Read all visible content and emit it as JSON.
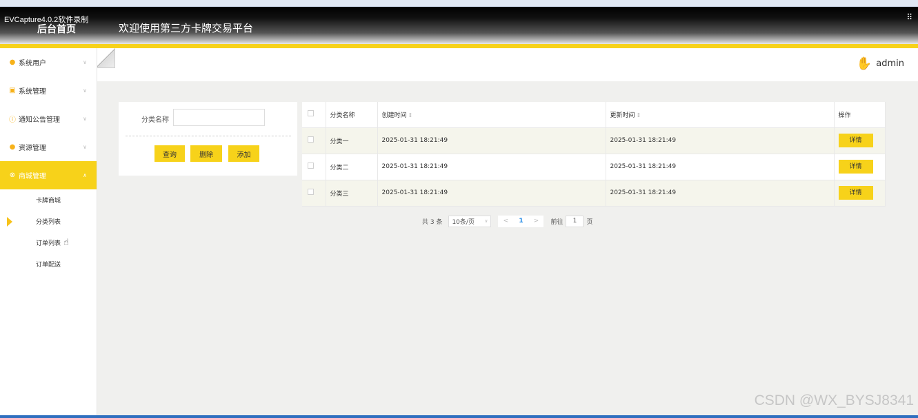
{
  "header": {
    "recorder": "EVCapture4.0.2软件录制",
    "home_title": "后台首页",
    "welcome": "欢迎使用第三方卡牌交易平台",
    "corner_icon": "resize-icon"
  },
  "user": {
    "name": "admin"
  },
  "sidebar": {
    "items": [
      {
        "label": "系统用户",
        "icon": "user-icon",
        "color": "#f7b21a"
      },
      {
        "label": "系统管理",
        "icon": "image-icon",
        "color": "#f7b21a"
      },
      {
        "label": "通知公告管理",
        "icon": "info-icon",
        "color": "#f7b21a"
      },
      {
        "label": "资源管理",
        "icon": "location-icon",
        "color": "#f7b21a"
      },
      {
        "label": "商城管理",
        "icon": "cart-icon",
        "active": true
      }
    ],
    "sub_items": [
      {
        "label": "卡牌商城"
      },
      {
        "label": "分类列表",
        "selected": true
      },
      {
        "label": "订单列表"
      },
      {
        "label": "订单配送"
      }
    ]
  },
  "search": {
    "label": "分类名称",
    "value": "",
    "query_label": "查询",
    "delete_label": "删除",
    "add_label": "添加"
  },
  "table": {
    "headers": [
      "分类名称",
      "创建时间",
      "更新时间",
      "操作"
    ],
    "sort_glyph": "⇕",
    "rows": [
      {
        "name": "分类一",
        "created": "2025-01-31 18:21:49",
        "updated": "2025-01-31 18:21:49",
        "action": "详情"
      },
      {
        "name": "分类二",
        "created": "2025-01-31 18:21:49",
        "updated": "2025-01-31 18:21:49",
        "action": "详情"
      },
      {
        "name": "分类三",
        "created": "2025-01-31 18:21:49",
        "updated": "2025-01-31 18:21:49",
        "action": "详情"
      }
    ]
  },
  "pagination": {
    "total": "共 3 条",
    "page_size": "10条/页",
    "prev": "<",
    "current": "1",
    "next": ">",
    "goto_label": "前往",
    "goto_value": "1",
    "goto_unit": "页"
  },
  "watermark": "CSDN @WX_BYSJ8341",
  "colors": {
    "accent": "#f7d21a",
    "link": "#1e88e5"
  }
}
